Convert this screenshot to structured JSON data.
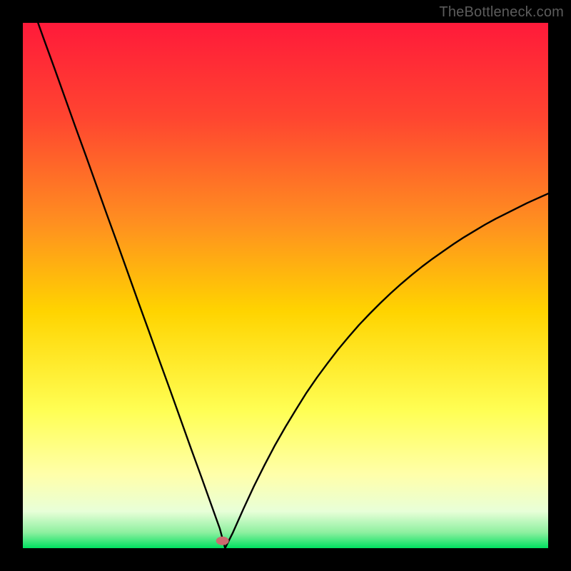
{
  "watermark": "TheBottleneck.com",
  "colors": {
    "black": "#000000",
    "curve": "#000000",
    "gradient_top": "#ff1a3a",
    "gradient_mid1": "#ff6a2a",
    "gradient_mid2": "#ffd400",
    "gradient_mid3": "#ffff66",
    "gradient_mid4": "#ffffaa",
    "gradient_bottom_pale": "#e8ffe0",
    "gradient_bottom": "#00e060",
    "marker": "#cc6b6f"
  },
  "chart_data": {
    "type": "line",
    "title": "",
    "xlabel": "",
    "ylabel": "",
    "xlim": [
      0,
      100
    ],
    "ylim": [
      0,
      100
    ],
    "x": [
      0,
      2,
      4,
      6,
      8,
      10,
      12,
      14,
      16,
      18,
      20,
      22,
      24,
      26,
      28,
      30,
      32,
      34,
      36,
      37.5,
      38.5,
      40,
      42,
      44,
      46,
      48,
      50,
      52,
      54,
      56,
      58,
      60,
      62,
      64,
      66,
      68,
      70,
      72,
      74,
      76,
      78,
      80,
      82,
      84,
      86,
      88,
      90,
      92,
      94,
      96,
      98,
      100
    ],
    "values": [
      108,
      102.5,
      96.9,
      91.4,
      85.8,
      80.2,
      74.7,
      69.1,
      63.5,
      58.0,
      52.4,
      46.8,
      41.3,
      35.7,
      30.2,
      24.6,
      19.0,
      13.5,
      7.9,
      3.7,
      0.0,
      3.0,
      7.5,
      11.8,
      15.8,
      19.6,
      23.1,
      26.4,
      29.6,
      32.5,
      35.2,
      37.8,
      40.2,
      42.5,
      44.6,
      46.6,
      48.5,
      50.3,
      52.0,
      53.6,
      55.1,
      56.5,
      57.9,
      59.2,
      60.4,
      61.6,
      62.7,
      63.7,
      64.7,
      65.7,
      66.6,
      67.5
    ],
    "marker": {
      "x": 38,
      "y": 1.4
    },
    "notes": "Bottleneck percent curve with minimum near x≈38. Background gradient runs red→orange→yellow→pale→green from top to bottom."
  }
}
